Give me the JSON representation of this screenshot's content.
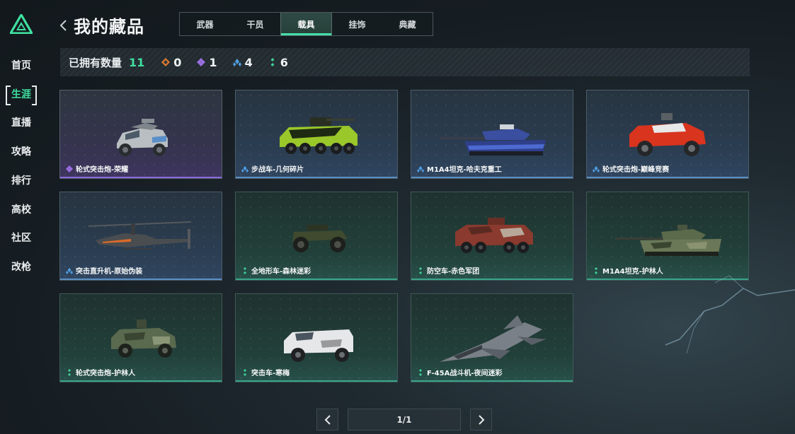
{
  "sidebar": {
    "items": [
      {
        "label": "首页"
      },
      {
        "label": "生涯",
        "active": true
      },
      {
        "label": "直播"
      },
      {
        "label": "攻略"
      },
      {
        "label": "排行"
      },
      {
        "label": "高校"
      },
      {
        "label": "社区"
      },
      {
        "label": "改枪"
      }
    ]
  },
  "header": {
    "title": "我的藏品",
    "tabs": [
      {
        "label": "武器"
      },
      {
        "label": "干员"
      },
      {
        "label": "载具",
        "active": true
      },
      {
        "label": "挂饰"
      },
      {
        "label": "典藏"
      }
    ]
  },
  "summary": {
    "label": "已拥有数量",
    "count": "11",
    "rarities": [
      {
        "icon": "orange-rarity-icon",
        "color": "#e0792f",
        "value": "0"
      },
      {
        "icon": "purple-rarity-icon",
        "color": "#9a6ee0",
        "value": "1"
      },
      {
        "icon": "blue-rarity-icon",
        "color": "#4f9de0",
        "value": "4"
      },
      {
        "icon": "green-rarity-icon",
        "color": "#3fcf95",
        "value": "6"
      }
    ]
  },
  "items": [
    {
      "name": "轮式突击炮-荣耀",
      "rarity": "purple",
      "vehicle": "armored-car-icon"
    },
    {
      "name": "步战车-几何碎片",
      "rarity": "blue",
      "vehicle": "ifv-icon"
    },
    {
      "name": "M1A4坦克-哈夫克重工",
      "rarity": "blue",
      "vehicle": "tank-icon"
    },
    {
      "name": "轮式突击炮-巅峰竞赛",
      "rarity": "blue",
      "vehicle": "armored-car-icon"
    },
    {
      "name": "突击直升机-原始伪装",
      "rarity": "blue",
      "vehicle": "helicopter-icon"
    },
    {
      "name": "全地形车-森林迷彩",
      "rarity": "green",
      "vehicle": "atv-icon"
    },
    {
      "name": "防空车-赤色军团",
      "rarity": "green",
      "vehicle": "ifv-icon"
    },
    {
      "name": "M1A4坦克-护林人",
      "rarity": "green",
      "vehicle": "tank-icon"
    },
    {
      "name": "轮式突击炮-护林人",
      "rarity": "green",
      "vehicle": "armored-car-icon"
    },
    {
      "name": "突击车-寒梅",
      "rarity": "green",
      "vehicle": "truck-icon"
    },
    {
      "name": "F-45A战斗机-夜间迷彩",
      "rarity": "green",
      "vehicle": "jet-icon"
    }
  ],
  "pagination": {
    "display": "1/1"
  },
  "colors": {
    "accent": "#3fe0a0",
    "purple": "#9a6ee0",
    "blue": "#4f9de0",
    "green": "#3fcf95",
    "orange": "#e0792f"
  }
}
